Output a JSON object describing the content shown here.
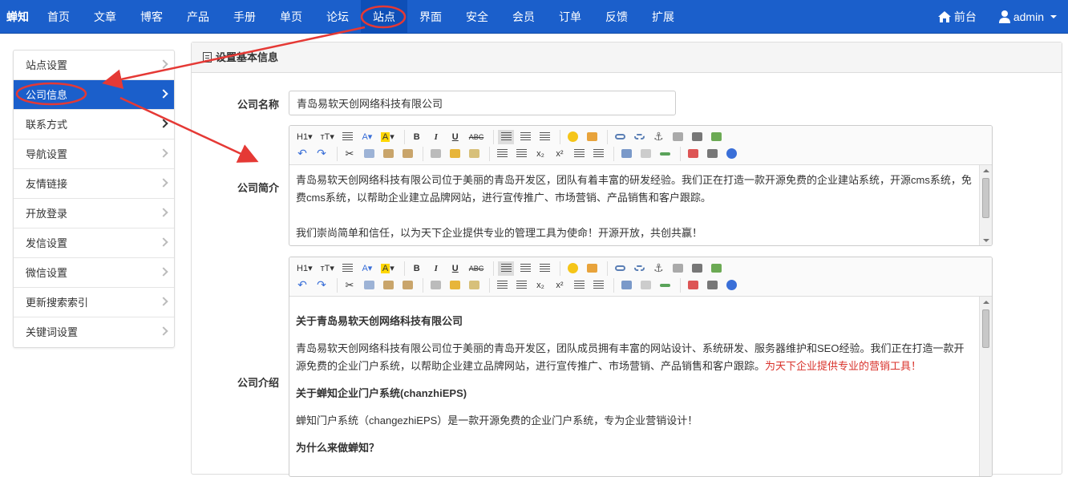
{
  "nav": {
    "brand": "蝉知",
    "items": [
      "首页",
      "文章",
      "博客",
      "产品",
      "手册",
      "单页",
      "论坛",
      "站点",
      "界面",
      "安全",
      "会员",
      "订单",
      "反馈",
      "扩展"
    ],
    "active_index": 7,
    "frontend_label": "前台",
    "user_label": "admin"
  },
  "sidebar": {
    "items": [
      {
        "label": "站点设置"
      },
      {
        "label": "公司信息"
      },
      {
        "label": "联系方式"
      },
      {
        "label": "导航设置"
      },
      {
        "label": "友情链接"
      },
      {
        "label": "开放登录"
      },
      {
        "label": "发信设置"
      },
      {
        "label": "微信设置"
      },
      {
        "label": "更新搜索索引"
      },
      {
        "label": "关键词设置"
      }
    ],
    "active_index": 1
  },
  "panel": {
    "title": "设置基本信息"
  },
  "form": {
    "name_label": "公司名称",
    "name_value": "青岛易软天创网络科技有限公司",
    "desc_label": "公司简介",
    "desc_p1": "青岛易软天创网络科技有限公司位于美丽的青岛开发区，团队有着丰富的研发经验。我们正在打造一款开源免费的企业建站系统，开源cms系统，免费cms系统，以帮助企业建立品牌网站，进行宣传推广、市场营销、产品销售和客户跟踪。",
    "desc_p2": "我们崇尚简单和信任，以为天下企业提供专业的管理工具为使命！开源开放，共创共赢！",
    "intro_label": "公司介绍",
    "intro_h1": "关于青岛易软天创网络科技有限公司",
    "intro_p1": "青岛易软天创网络科技有限公司位于美丽的青岛开发区，团队成员拥有丰富的网站设计、系统研发、服务器维护和SEO经验。我们正在打造一款开源免费的企业门户系统，以帮助企业建立品牌网站，进行宣传推广、市场营销、产品销售和客户跟踪。",
    "intro_p1_red": "为天下企业提供专业的营销工具！",
    "intro_h2": "关于蝉知企业门户系统(chanzhiEPS)",
    "intro_p2": "蝉知门户系统（changezhiEPS）是一款开源免费的企业门户系统，专为企业营销设计！",
    "intro_h3": "为什么来做蝉知？"
  },
  "toolbar": {
    "heading": "H1",
    "fontsize": "тT",
    "fontcolor": "A",
    "bgcolor": "A",
    "bold": "B",
    "italic": "I",
    "underline": "U",
    "strike": "ABC",
    "sub": "x₂",
    "sup": "x²"
  },
  "colors": {
    "nav_bg": "#1b5fcb",
    "active_bg": "#1b5fcb",
    "annotation": "#e53935"
  }
}
